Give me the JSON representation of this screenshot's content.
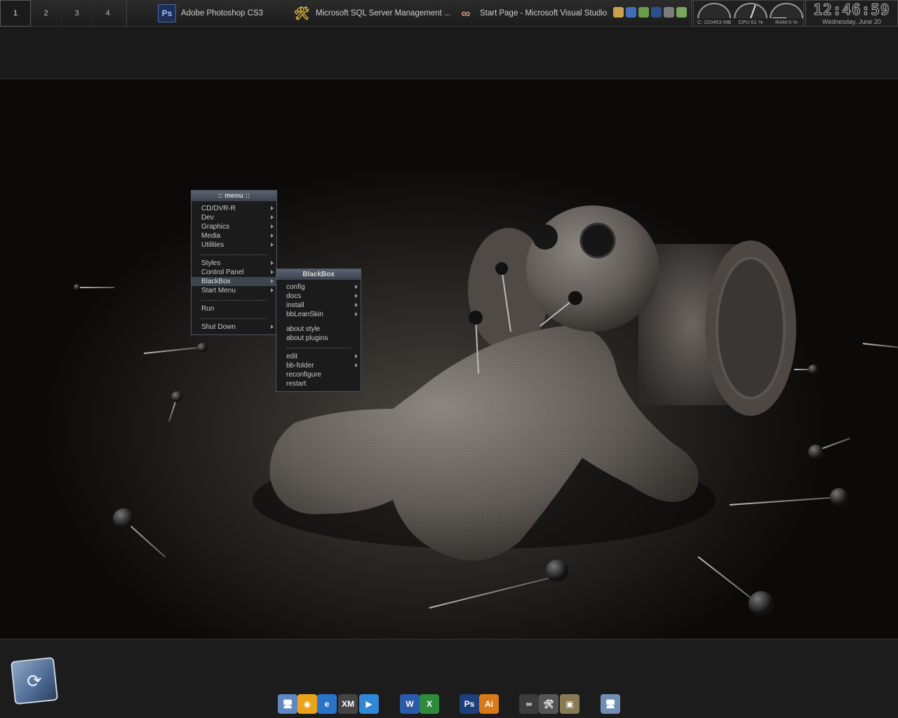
{
  "workspaces": [
    "1",
    "2",
    "3",
    "4"
  ],
  "tasks": [
    {
      "icon": "photoshop-icon",
      "icon_text": "Ps",
      "label": "Adobe Photoshop CS3"
    },
    {
      "icon": "sql-server-icon",
      "icon_text": "🛠",
      "label": "Microsoft SQL Server Management ..."
    },
    {
      "icon": "visual-studio-icon",
      "icon_text": "∞",
      "label": "Start Page - Microsoft Visual Studio"
    }
  ],
  "tray_colors": [
    "#c9a14a",
    "#3f6fb5",
    "#6b9c4a",
    "#2c4f8a",
    "#7d7d7d",
    "#7aa55c"
  ],
  "gauges": [
    {
      "label": "C: 220453 MB"
    },
    {
      "label": "CPU 61 %",
      "value": 61
    },
    {
      "label": "RAM 0 %",
      "value": 0
    }
  ],
  "clock": {
    "time": "12:46:59",
    "date": "Wednesday, June 20"
  },
  "main_menu": {
    "title": ":: menu ::",
    "items": [
      {
        "label": "CD/DVR-R",
        "submenu": true
      },
      {
        "label": "Dev",
        "submenu": true
      },
      {
        "label": "Graphics",
        "submenu": true
      },
      {
        "label": "Media",
        "submenu": true
      },
      {
        "label": "Utilities",
        "submenu": true
      },
      {
        "sep": true
      },
      {
        "label": "Styles",
        "submenu": true
      },
      {
        "label": "Control Panel",
        "submenu": true
      },
      {
        "label": "BlackBox",
        "submenu": true,
        "selected": true
      },
      {
        "label": "Start Menu",
        "submenu": true
      },
      {
        "sep": true
      },
      {
        "label": "Run",
        "submenu": false
      },
      {
        "sep": true
      },
      {
        "label": "Shut Down",
        "submenu": true
      }
    ]
  },
  "blackbox_menu": {
    "title": "BlackBox",
    "items": [
      {
        "label": "config",
        "submenu": true
      },
      {
        "label": "docs",
        "submenu": true
      },
      {
        "label": "install",
        "submenu": true
      },
      {
        "label": "bbLeanSkin",
        "submenu": true
      },
      {
        "gap": true
      },
      {
        "label": "about style",
        "submenu": false
      },
      {
        "label": "about plugins",
        "submenu": false
      },
      {
        "sep": true
      },
      {
        "label": "edit",
        "submenu": true
      },
      {
        "label": "bb-folder",
        "submenu": true
      },
      {
        "label": "reconfigure",
        "submenu": false
      },
      {
        "label": "restart",
        "submenu": false
      }
    ]
  },
  "dock": [
    {
      "name": "network-icon",
      "text": "🖥",
      "bg": "#5f87c2"
    },
    {
      "name": "aim-icon",
      "text": "◉",
      "bg": "#e9a21b"
    },
    {
      "name": "internet-explorer-icon",
      "text": "e",
      "bg": "#2a73c7"
    },
    {
      "name": "xmplay-icon",
      "text": "XM",
      "bg": "#444444"
    },
    {
      "name": "media-player-icon",
      "text": "▶",
      "bg": "#2f87d6"
    },
    {
      "name": "word-icon",
      "text": "W",
      "bg": "#2b5aa8"
    },
    {
      "name": "excel-icon",
      "text": "X",
      "bg": "#2e8a3c"
    },
    {
      "name": "photoshop-dock-icon",
      "text": "Ps",
      "bg": "#1d3f7a"
    },
    {
      "name": "illustrator-dock-icon",
      "text": "Ai",
      "bg": "#d97a16"
    },
    {
      "name": "visual-studio-dock-icon",
      "text": "∞",
      "bg": "#3c3c3c"
    },
    {
      "name": "sql-dock-icon",
      "text": "🛠",
      "bg": "#555555"
    },
    {
      "name": "explorer-dock-icon",
      "text": "▣",
      "bg": "#8a7a54"
    },
    {
      "name": "remote-desktop-icon",
      "text": "🖥",
      "bg": "#6f8fb5"
    }
  ],
  "big_icon": {
    "name": "refresh-box-icon",
    "text": "⟳"
  }
}
